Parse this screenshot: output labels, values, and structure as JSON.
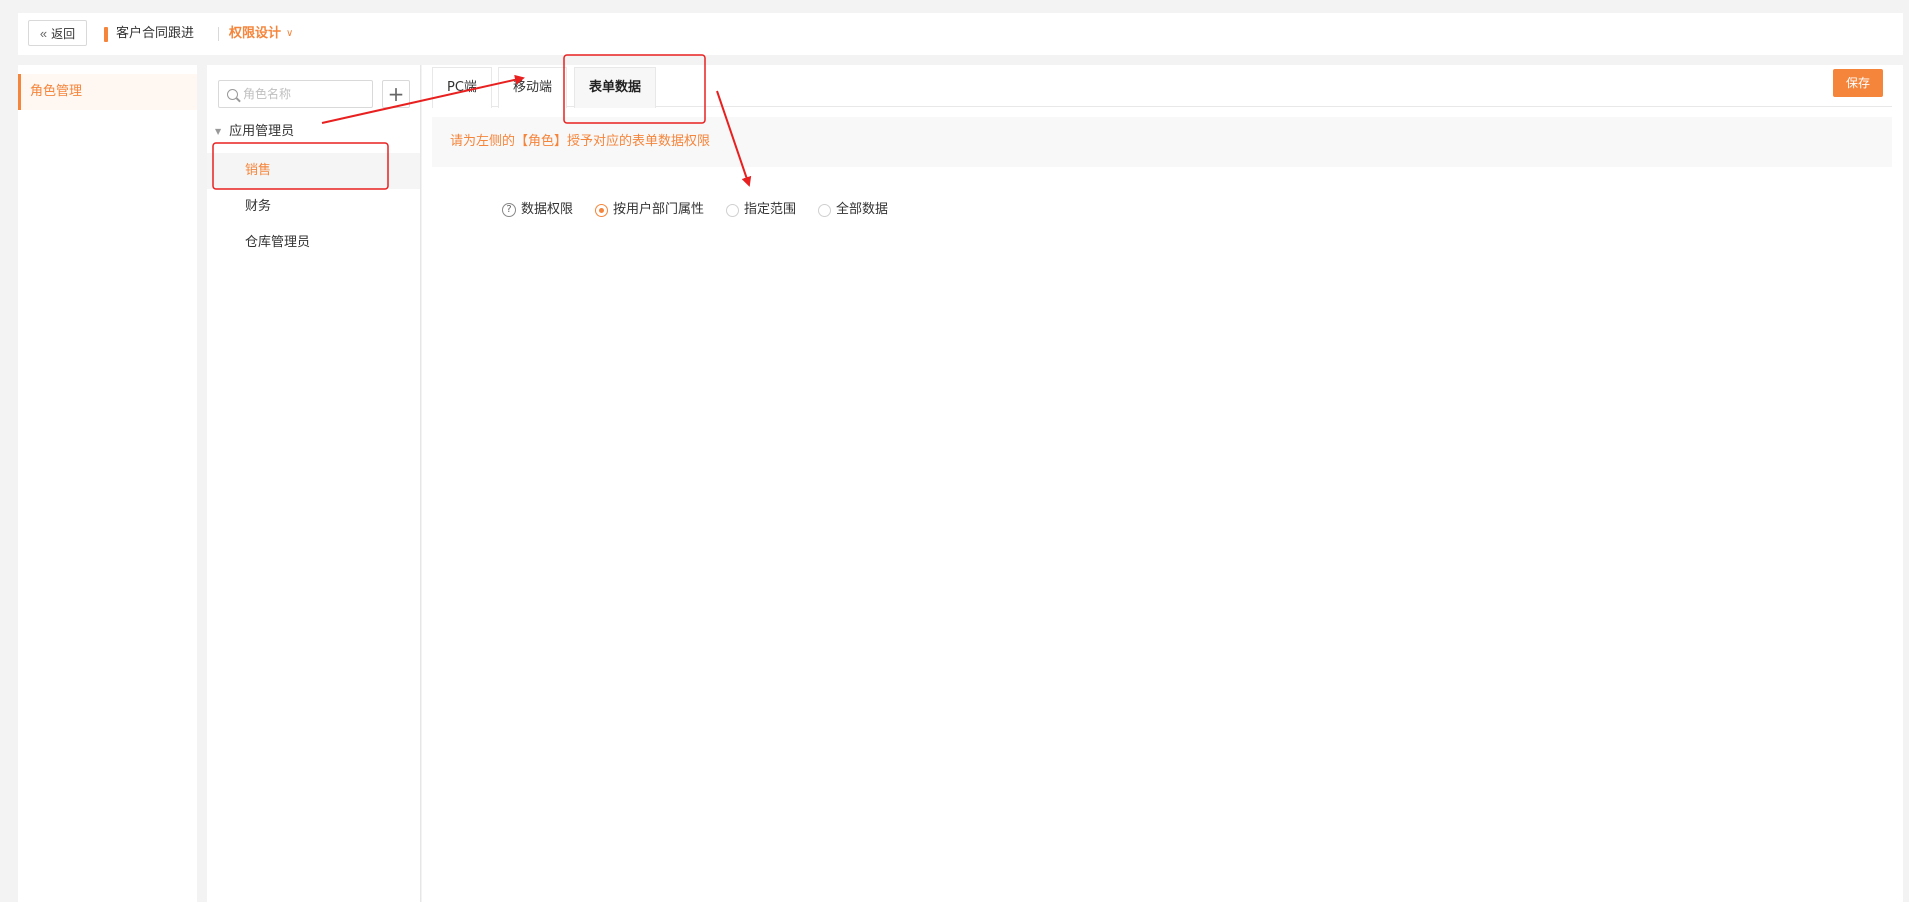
{
  "header": {
    "back_label": "返回",
    "app_name": "客户合同跟进",
    "current_page": "权限设计"
  },
  "left_nav": {
    "items": [
      {
        "label": "角色管理",
        "active": true
      }
    ]
  },
  "roles": {
    "search_placeholder": "角色名称",
    "group": "应用管理员",
    "items": [
      {
        "label": "销售",
        "active": true
      },
      {
        "label": "财务",
        "active": false
      },
      {
        "label": "仓库管理员",
        "active": false
      }
    ]
  },
  "main": {
    "tabs": [
      {
        "label": "PC端",
        "active": false
      },
      {
        "label": "移动端",
        "active": false
      },
      {
        "label": "表单数据",
        "active": true
      }
    ],
    "save_label": "保存",
    "notice": "请为左侧的【角色】授予对应的表单数据权限",
    "data_permission": {
      "label": "数据权限",
      "options": [
        {
          "label": "按用户部门属性",
          "checked": true
        },
        {
          "label": "指定范围",
          "checked": false
        },
        {
          "label": "全部数据",
          "checked": false
        }
      ]
    }
  },
  "colors": {
    "accent": "#f5853b",
    "annotation": "#e8201f"
  }
}
